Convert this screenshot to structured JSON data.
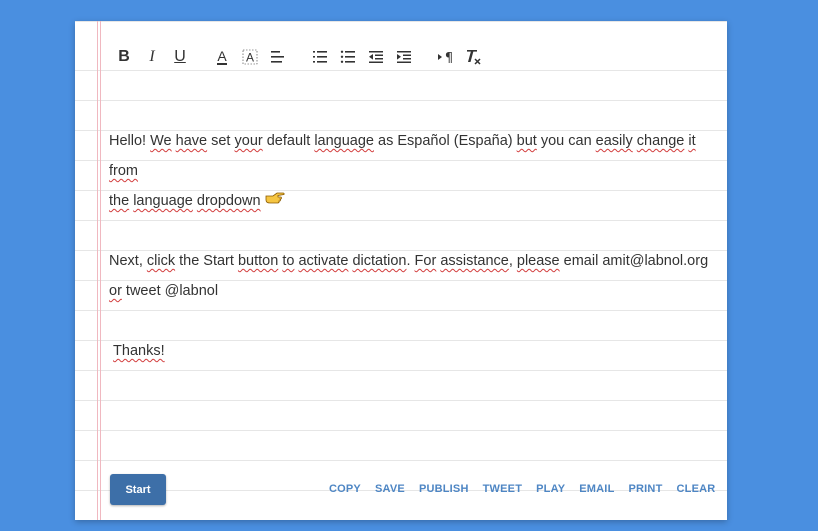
{
  "toolbar": {
    "bold": "B",
    "italic": "I",
    "underline": "U",
    "font_color": "A"
  },
  "document": {
    "para1_a": "Hello!  ",
    "para1_we": "We",
    "para1_b": " ",
    "para1_have": "have",
    "para1_c": " set ",
    "para1_your": "your",
    "para1_d": " default ",
    "para1_language": "language",
    "para1_e": " as  Español (España) ",
    "para1_but": "but",
    "para1_f": " you can ",
    "para1_easily": "easily",
    "para1_g": " ",
    "para1_change": "change",
    "para1_h": " ",
    "para1_it": "it",
    "para1_i": " ",
    "para1_from": "from",
    "para1_the": "the",
    "para1_j": " ",
    "para1_language2": "language",
    "para1_k": " ",
    "para1_dropdown": "dropdown",
    "para2_a": " Next, ",
    "para2_click": "click",
    "para2_b": " the Start ",
    "para2_button": "button",
    "para2_c": " ",
    "para2_to": "to",
    "para2_d": " ",
    "para2_activate": "activate",
    "para2_e": " ",
    "para2_dictation": "dictation",
    "para2_f": ".  ",
    "para2_for": "For",
    "para2_g": " ",
    "para2_assistance": "assistance",
    "para2_h": ",  ",
    "para2_please": "please",
    "para2_i": " email amit@labnol.org",
    "para2_or": "or",
    "para2_j": " tweet @labnol",
    "para3": "Thanks!"
  },
  "footer": {
    "start_label": "Start",
    "actions": [
      "COPY",
      "SAVE",
      "PUBLISH",
      "TWEET",
      "PLAY",
      "EMAIL",
      "PRINT",
      "CLEAR"
    ]
  },
  "colors": {
    "background": "#4a8fe0",
    "start_button": "#3d6fa8",
    "action_link": "#4e86c4",
    "spellcheck": "#d23c3c"
  }
}
